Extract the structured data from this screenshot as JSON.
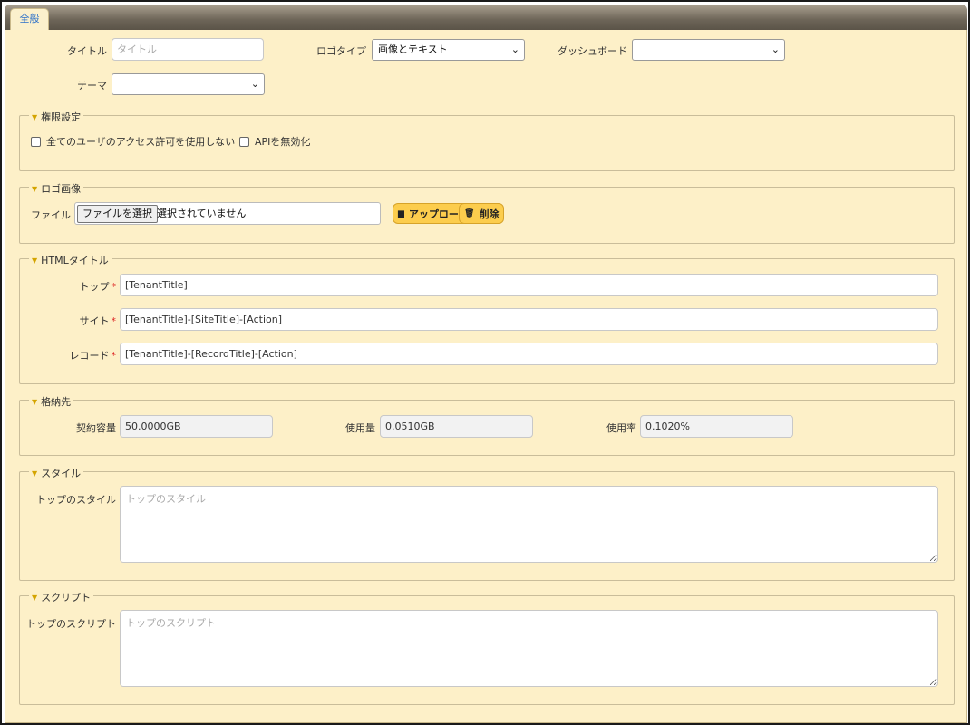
{
  "tabs": [
    {
      "label": "全般"
    }
  ],
  "general": {
    "title_label": "タイトル",
    "title_placeholder": "タイトル",
    "logo_type_label": "ロゴタイプ",
    "logo_type_value": "画像とテキスト",
    "dashboard_label": "ダッシュボード",
    "dashboard_value": "",
    "theme_label": "テーマ",
    "theme_value": ""
  },
  "permissions": {
    "legend": "権限設定",
    "disable_all_user_access": "全てのユーザのアクセス許可を使用しない",
    "disable_api": "APIを無効化"
  },
  "logo_image": {
    "legend": "ロゴ画像",
    "file_label": "ファイル",
    "choose_file_button": "ファイルを選択",
    "no_file_text": "選択されていません",
    "upload_button": "アップロード",
    "delete_button": "削除"
  },
  "html_title": {
    "legend": "HTMLタイトル",
    "top_label": "トップ",
    "top_value": "[TenantTitle]",
    "site_label": "サイト",
    "site_value": "[TenantTitle]-[SiteTitle]-[Action]",
    "record_label": "レコード",
    "record_value": "[TenantTitle]-[RecordTitle]-[Action]",
    "required_mark": "*"
  },
  "storage": {
    "legend": "格納先",
    "contract_label": "契約容量",
    "contract_value": "50.0000GB",
    "usage_label": "使用量",
    "usage_value": "0.0510GB",
    "rate_label": "使用率",
    "rate_value": "0.1020%"
  },
  "style": {
    "legend": "スタイル",
    "top_style_label": "トップのスタイル",
    "top_style_placeholder": "トップのスタイル"
  },
  "script": {
    "legend": "スクリプト",
    "top_script_label": "トップのスクリプト",
    "top_script_placeholder": "トップのスクリプト"
  },
  "icons": {
    "legend_toggle": "triangle-down-icon",
    "select_caret": "chevron-down-icon",
    "upload": "floppy-disk-icon",
    "delete": "trash-icon"
  },
  "colors": {
    "panel_background": "#fdf0c8",
    "button_background": "#fccd4d",
    "tab_label": "#2a6fc9",
    "required": "#dd2222",
    "legend_triangle": "#d4a400"
  }
}
